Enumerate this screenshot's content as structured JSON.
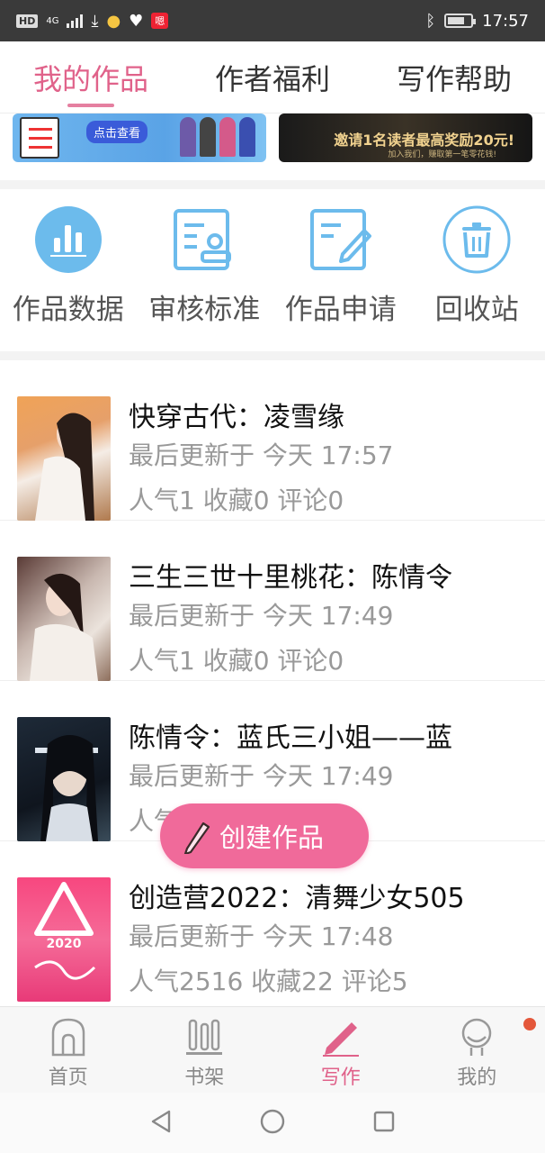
{
  "status_bar": {
    "hd": "HD",
    "net": "4G",
    "notif": "嗯",
    "time": "17:57"
  },
  "tabs": [
    {
      "label": "我的作品",
      "active": true
    },
    {
      "label": "作者福利",
      "active": false
    },
    {
      "label": "写作帮助",
      "active": false
    }
  ],
  "banners": {
    "left_button": "点击查看",
    "right_line1": "邀请1名读者最高奖励20元!",
    "right_line2": "邀请1名读者最高奖励20元!",
    "right_line3": "加入我们，赚取第一笔零花钱!"
  },
  "tools": [
    {
      "label": "作品数据",
      "icon": "bar-chart-icon"
    },
    {
      "label": "审核标准",
      "icon": "review-stamp-icon"
    },
    {
      "label": "作品申请",
      "icon": "edit-doc-icon"
    },
    {
      "label": "回收站",
      "icon": "trash-icon"
    }
  ],
  "works": [
    {
      "title": "快穿古代：凌雪缘",
      "updated": "最后更新于 今天 17:57",
      "stats": "人气1 收藏0 评论0"
    },
    {
      "title": "三生三世十里桃花：陈情令",
      "updated": "最后更新于 今天 17:49",
      "stats": "人气1 收藏0 评论0"
    },
    {
      "title": "陈情令：蓝氏三小姐——蓝",
      "updated": "最后更新于 今天 17:49",
      "stats": "人气1 收藏0 评论0"
    },
    {
      "title": "创造营2022：清舞少女505",
      "updated": "最后更新于 今天 17:48",
      "stats": "人气2516 收藏22 评论5"
    }
  ],
  "cover_text": "2020",
  "fab": {
    "label": "创建作品"
  },
  "bottom_nav": [
    {
      "label": "首页",
      "icon": "home-icon",
      "active": false
    },
    {
      "label": "书架",
      "icon": "bookshelf-icon",
      "active": false
    },
    {
      "label": "写作",
      "icon": "pen-icon",
      "active": true
    },
    {
      "label": "我的",
      "icon": "profile-icon",
      "active": false
    }
  ],
  "colors": {
    "accent": "#e0628a",
    "fab": "#f06a9a",
    "icon_blue": "#6cbbec"
  }
}
